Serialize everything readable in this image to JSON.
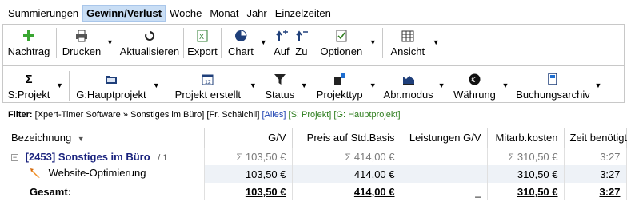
{
  "tabs": [
    "Summierungen",
    "Gewinn/Verlust",
    "Woche",
    "Monat",
    "Jahr",
    "Einzelzeiten"
  ],
  "toolbar1": {
    "nachtrag": "Nachtrag",
    "drucken": "Drucken",
    "aktualisieren": "Aktualisieren",
    "export": "Export",
    "chart": "Chart",
    "auf": "Auf",
    "zu": "Zu",
    "optionen": "Optionen",
    "ansicht": "Ansicht"
  },
  "toolbar2": {
    "sprojekt": "S:Projekt",
    "ghauptprojekt": "G:Hauptprojekt",
    "projekt_erstellt": "Projekt erstellt",
    "status": "Status",
    "projekttyp": "Projekttyp",
    "abr_modus": "Abr.modus",
    "waehrung": "Währung",
    "buchungsarchiv": "Buchungsarchiv"
  },
  "filter": {
    "label": "Filter:",
    "text": "[Xpert-Timer Software » Sonstiges im Büro] [Fr. Schälchli]",
    "alles": "[Alles]",
    "s_projekt": "[S: Projekt]",
    "g_hauptprojekt": "[G: Hauptprojekt]"
  },
  "table": {
    "headers": [
      "Bezeichnung",
      "G/V",
      "Preis auf Std.Basis",
      "Leistungen G/V",
      "Mitarb.kosten",
      "Zeit benötigt"
    ],
    "group": {
      "title": "[2453] Sonstiges im Büro",
      "count": "/ 1",
      "sigma": "Σ",
      "gv": "103,50 €",
      "preis": "414,00 €",
      "leistungen": "",
      "mitarb": "310,50 €",
      "zeit": "3:27"
    },
    "item": {
      "title": "Website-Optimierung",
      "gv": "103,50 €",
      "preis": "414,00 €",
      "leistungen": "",
      "mitarb": "310,50 €",
      "zeit": "3:27"
    },
    "total": {
      "title": "Gesamt:",
      "gv": "103,50 €",
      "preis": "414,00 €",
      "leistungen": "_",
      "mitarb": "310,50 €",
      "zeit": "3:27"
    }
  },
  "colors": {
    "active_tab": "#c9def5",
    "project_title": "#1a237e",
    "green_icon": "#3aa632"
  }
}
